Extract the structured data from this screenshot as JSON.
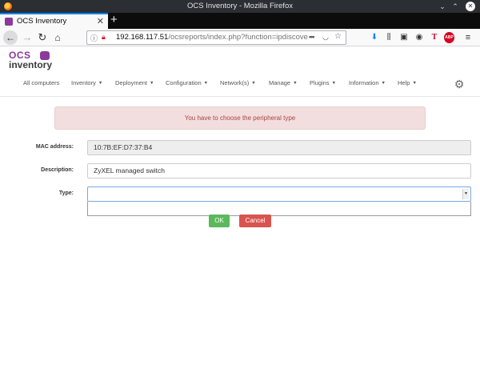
{
  "window": {
    "title": "OCS Inventory - Mozilla Firefox"
  },
  "tab": {
    "title": "OCS Inventory"
  },
  "browser": {
    "url_host": "192.168.117.51",
    "url_path": "/ocsreports/index.php?function=ipdiscove"
  },
  "brand": {
    "line1": "OCS",
    "line2": "inventory"
  },
  "menu": {
    "items": [
      {
        "label": "All computers",
        "has_caret": false
      },
      {
        "label": "Inventory",
        "has_caret": true
      },
      {
        "label": "Deployment",
        "has_caret": true
      },
      {
        "label": "Configuration",
        "has_caret": true
      },
      {
        "label": "Network(s)",
        "has_caret": true
      },
      {
        "label": "Manage",
        "has_caret": true
      },
      {
        "label": "Plugins",
        "has_caret": true
      },
      {
        "label": "Information",
        "has_caret": true
      },
      {
        "label": "Help",
        "has_caret": true
      }
    ]
  },
  "alert": {
    "text": "You have to choose the peripheral type"
  },
  "form": {
    "mac_label": "MAC address:",
    "mac_value": "10:7B:EF:D7:37:B4",
    "description_label": "Description:",
    "description_value": "ZyXEL managed switch",
    "type_label": "Type:",
    "type_value": ""
  },
  "buttons": {
    "ok": "OK",
    "cancel": "Cancel"
  },
  "colors": {
    "brand": "#8b3a9c",
    "alert_bg": "#f2dede",
    "alert_text": "#a94442",
    "ok": "#5cb85c",
    "cancel": "#d9534f"
  }
}
